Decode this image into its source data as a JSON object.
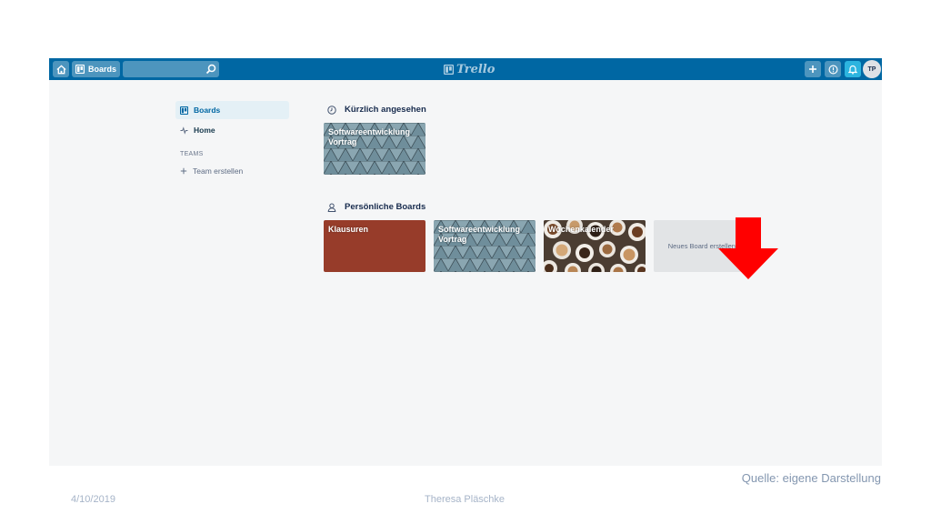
{
  "topbar": {
    "boards_label": "Boards",
    "search_placeholder": "",
    "logo_text": "Trello",
    "avatar_initials": "TP",
    "color": "#0067a3"
  },
  "sidebar": {
    "items": [
      {
        "label": "Boards",
        "icon": "board-icon",
        "active": true
      },
      {
        "label": "Home",
        "icon": "pulse-icon",
        "active": false
      }
    ],
    "teams_label": "TEAMS",
    "create_team_label": "Team erstellen"
  },
  "recent": {
    "heading": "Kürzlich angesehen",
    "boards": [
      {
        "title": "Softwareentwicklung Vortrag",
        "background": "geometric-pattern"
      }
    ]
  },
  "personal": {
    "heading": "Persönliche Boards",
    "boards": [
      {
        "title": "Klausuren",
        "background": "#973c2a"
      },
      {
        "title": "Softwareentwicklung Vortrag",
        "background": "geometric-pattern"
      },
      {
        "title": "Wochenkalender",
        "background": "coffee-cups-photo"
      }
    ],
    "new_board_label": "Neues Board erstellen..."
  },
  "annotation": {
    "arrow_color": "#ff0000",
    "source_text": "Quelle: eigene Darstellung"
  },
  "slide_footer": {
    "date": "4/10/2019",
    "author": "Theresa Pläschke"
  }
}
